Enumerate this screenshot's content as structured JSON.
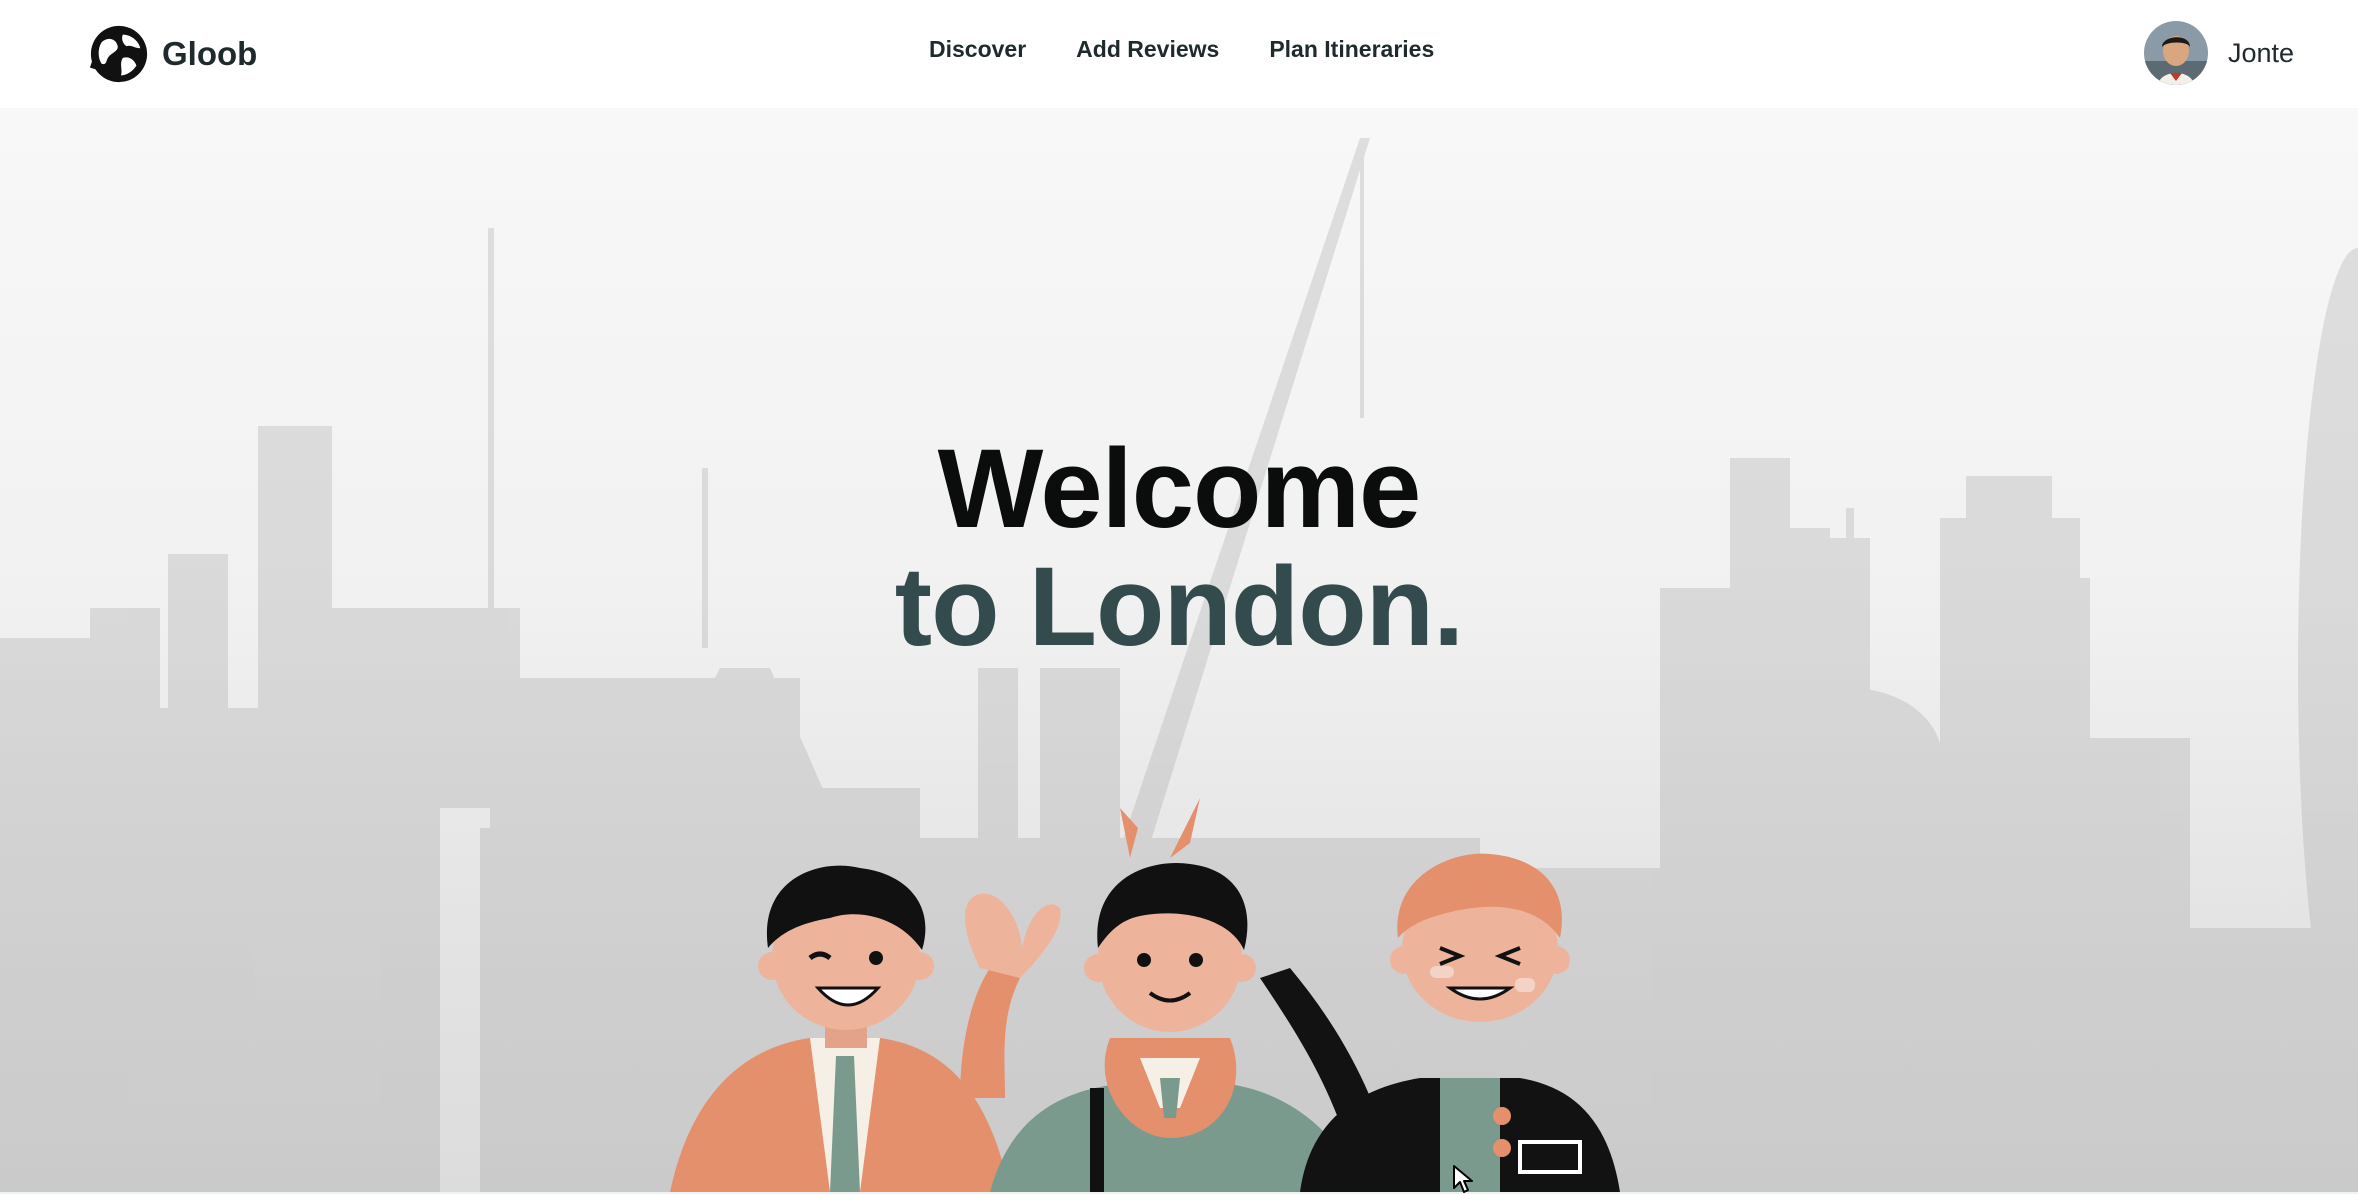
{
  "brand": {
    "name": "Gloob",
    "logo_icon": "globe-logo-icon"
  },
  "nav": {
    "items": [
      {
        "label": "Discover"
      },
      {
        "label": "Add Reviews"
      },
      {
        "label": "Plan Itineraries"
      }
    ]
  },
  "user": {
    "name": "Jonte",
    "avatar_icon": "user-avatar-icon"
  },
  "hero": {
    "line1": "Welcome",
    "line2": "to London."
  },
  "colors": {
    "heading_dark": "#0b0c0c",
    "heading_accent": "#344b4e",
    "illustration_orange": "#e5906c",
    "illustration_teal": "#7a9a8e",
    "illustration_black": "#121212"
  }
}
